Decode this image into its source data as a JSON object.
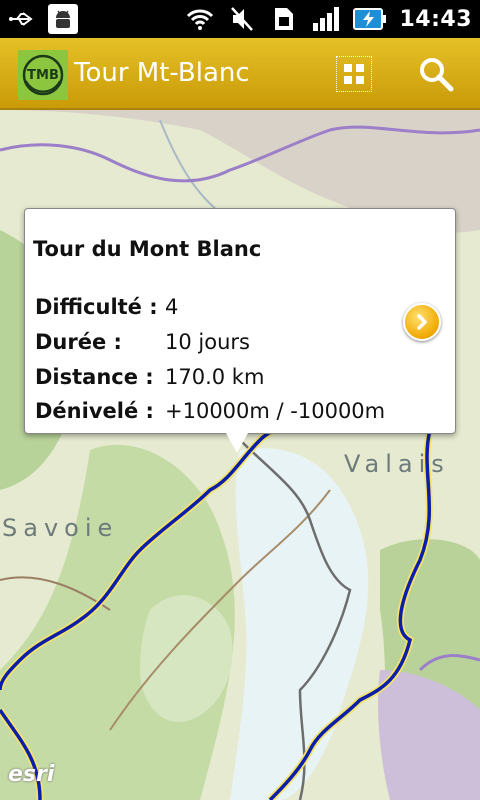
{
  "status_bar": {
    "time": "14:43",
    "icons": [
      "usb-icon",
      "android-debug-icon",
      "wifi-icon",
      "muted-icon",
      "sim-icon",
      "signal-icon",
      "battery-charging-icon"
    ]
  },
  "action_bar": {
    "logo_text": "TMB",
    "title": "Tour Mt-Blanc",
    "icons": [
      "grid-icon",
      "search-icon"
    ]
  },
  "map": {
    "labels": {
      "valais": "Valais",
      "savoie": "Savoie"
    },
    "attribution": "esri",
    "colors": {
      "route": "#0b1ea8",
      "border": "#9b7fc9",
      "land": "#e9ecd8",
      "ice": "#e8f3f6"
    }
  },
  "callout": {
    "title": "Tour du Mont Blanc",
    "rows": [
      {
        "label": "Difficulté :",
        "value": "4"
      },
      {
        "label": "Durée :",
        "value": "10 jours"
      },
      {
        "label": "Distance :",
        "value": "170.0 km"
      },
      {
        "label": "Dénivelé :",
        "value": "+10000m / -10000m"
      }
    ],
    "accent": "#f0a800"
  }
}
